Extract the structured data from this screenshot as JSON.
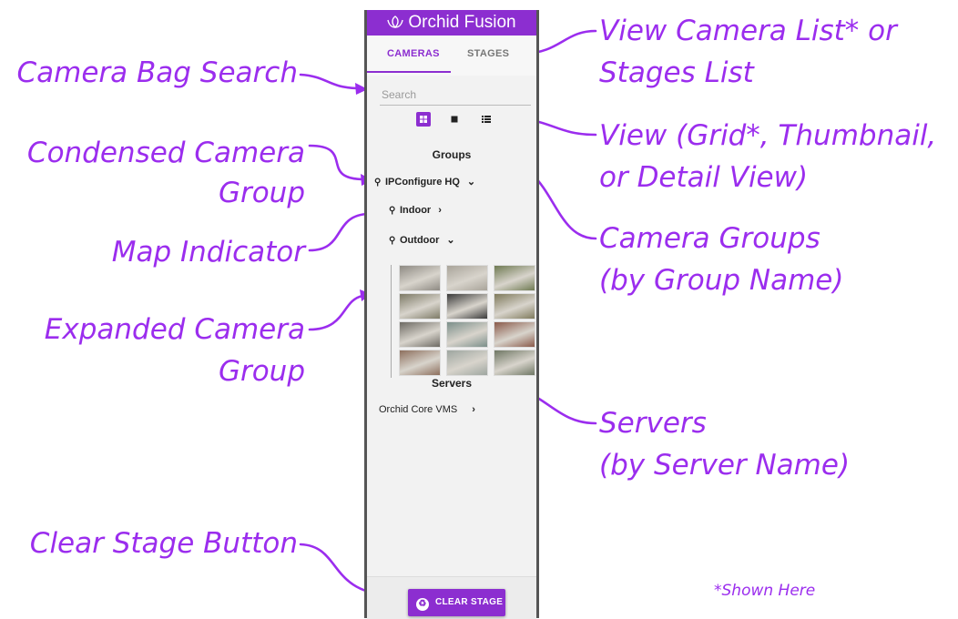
{
  "colors": {
    "accent": "#8c2ed0",
    "annotation": "#9b2dee"
  },
  "app": {
    "title": "Orchid Fusion",
    "logo_icon": "lotus-icon"
  },
  "tabs": [
    {
      "label": "CAMERAS",
      "active": true
    },
    {
      "label": "STAGES",
      "active": false
    }
  ],
  "search": {
    "placeholder": "Search",
    "value": ""
  },
  "view_modes": [
    {
      "name": "grid",
      "icon": "grid-icon",
      "active": true
    },
    {
      "name": "thumbnail",
      "icon": "square-icon",
      "active": false
    },
    {
      "name": "detail",
      "icon": "list-icon",
      "active": false
    }
  ],
  "groups": {
    "heading": "Groups",
    "items": [
      {
        "label": "IPConfigure HQ",
        "expanded": true,
        "map": true
      },
      {
        "label": "Indoor",
        "expanded": false,
        "map": true
      },
      {
        "label": "Outdoor",
        "expanded": true,
        "map": true
      }
    ]
  },
  "camera_thumbnails": [
    {
      "name": "camera-1",
      "color": "#8e8a83"
    },
    {
      "name": "camera-2",
      "color": "#a9a49a"
    },
    {
      "name": "camera-3",
      "color": "#6f7a52"
    },
    {
      "name": "camera-4",
      "color": "#7d7a66"
    },
    {
      "name": "camera-5",
      "color": "#3a3a3a"
    },
    {
      "name": "camera-6",
      "color": "#7f7a5c"
    },
    {
      "name": "camera-7",
      "color": "#6d6a63"
    },
    {
      "name": "camera-8",
      "color": "#7b8f8a"
    },
    {
      "name": "camera-9",
      "color": "#8a5a4a"
    },
    {
      "name": "camera-10",
      "color": "#8d6f5d"
    },
    {
      "name": "camera-11",
      "color": "#9ea6a0"
    },
    {
      "name": "camera-12",
      "color": "#6f7764"
    }
  ],
  "servers": {
    "heading": "Servers",
    "items": [
      {
        "label": "Orchid Core VMS",
        "expanded": false
      }
    ]
  },
  "clear_stage": {
    "label": "CLEAR STAGE",
    "icon": "recycle-icon"
  },
  "annotations": {
    "camera_bag_search": "Camera Bag Search",
    "condensed_group_line1": "Condensed Camera",
    "condensed_group_line2": "Group",
    "map_indicator": "Map Indicator",
    "expanded_group_line1": "Expanded Camera",
    "expanded_group_line2": "Group",
    "clear_stage_button": "Clear Stage Button",
    "view_list_line1": "View Camera List* or",
    "view_list_line2": "Stages List",
    "view_modes_line1": "View (Grid*, Thumbnail,",
    "view_modes_line2": "or Detail View)",
    "camera_groups_line1": "Camera Groups",
    "camera_groups_line2": "(by Group Name)",
    "servers_line1": "Servers",
    "servers_line2": "(by Server Name)",
    "shown_here": "*Shown Here"
  }
}
